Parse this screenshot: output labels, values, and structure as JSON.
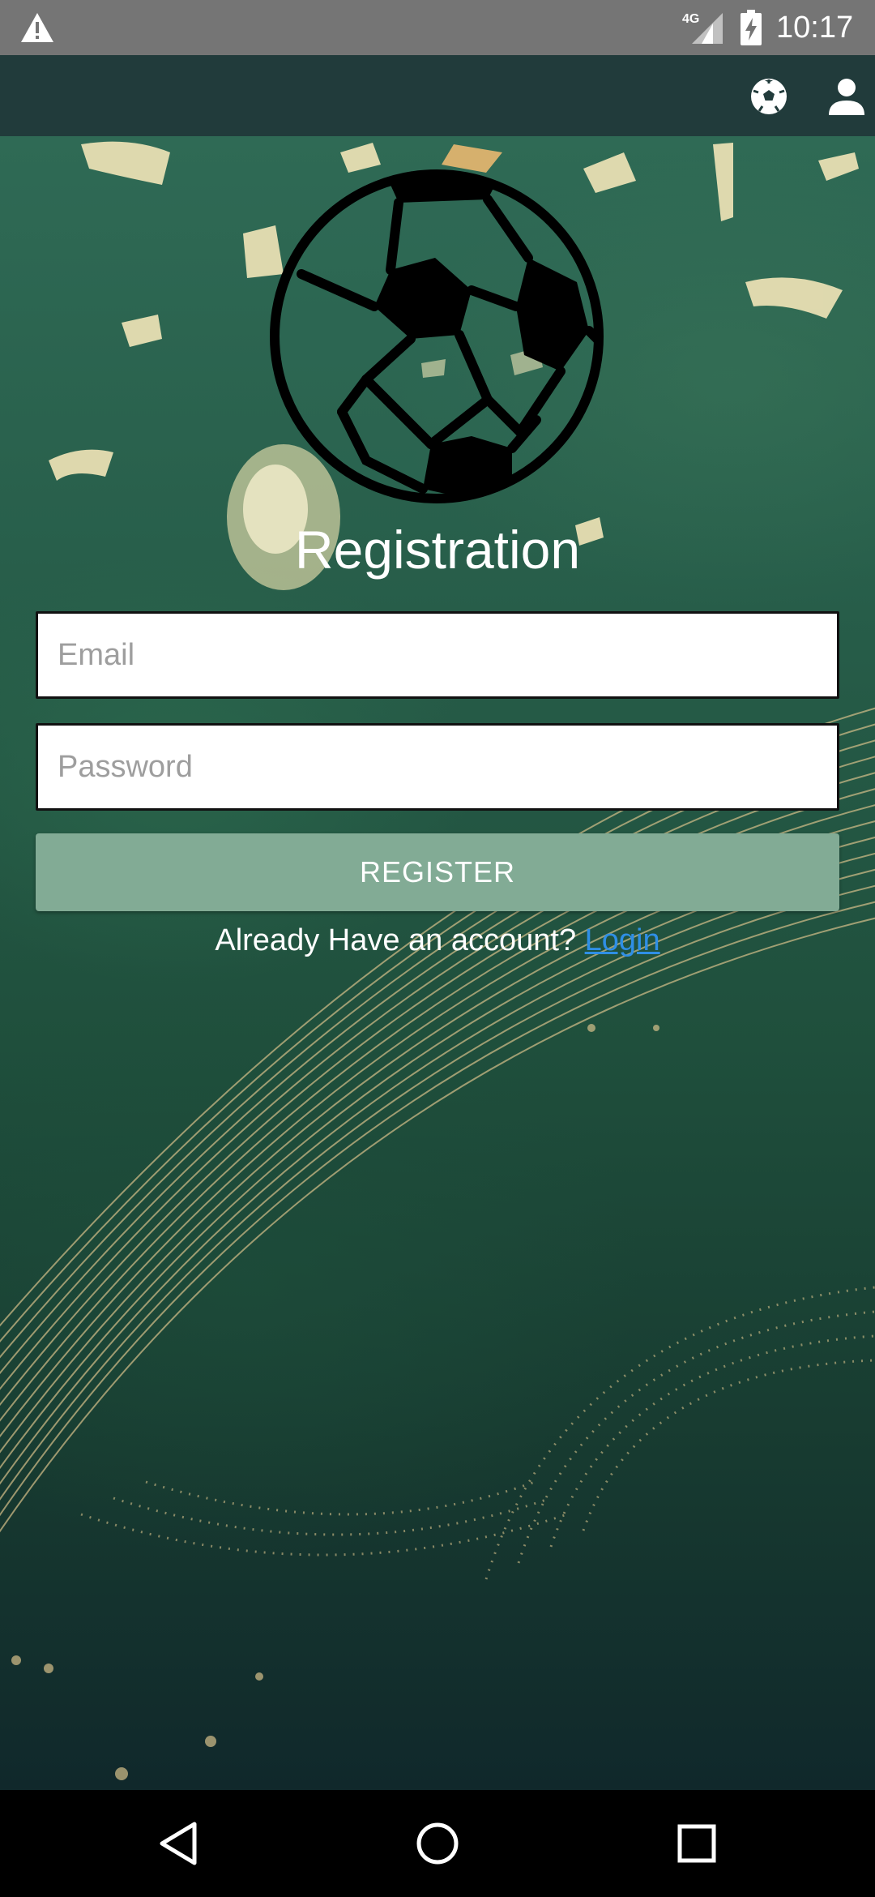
{
  "status_bar": {
    "network": "4G",
    "time": "10:17",
    "icons": [
      "warning-icon",
      "signal-icon",
      "battery-charging-icon"
    ]
  },
  "app_bar": {
    "icons": [
      "soccer-ball-icon",
      "person-icon"
    ]
  },
  "form": {
    "title": "Registration",
    "email_placeholder": "Email",
    "email_value": "",
    "password_placeholder": "Password",
    "password_value": "",
    "register_label": "REGISTER",
    "account_prompt": "Already Have an account? ",
    "login_link": "Login"
  },
  "nav_bar": {
    "icons": [
      "back-icon",
      "home-icon",
      "recents-icon"
    ]
  },
  "colors": {
    "status_bar": "#757575",
    "app_bar": "#213b3b",
    "register_button": "#82ab95",
    "link": "#2f8fe6",
    "background": "#285f4b"
  }
}
